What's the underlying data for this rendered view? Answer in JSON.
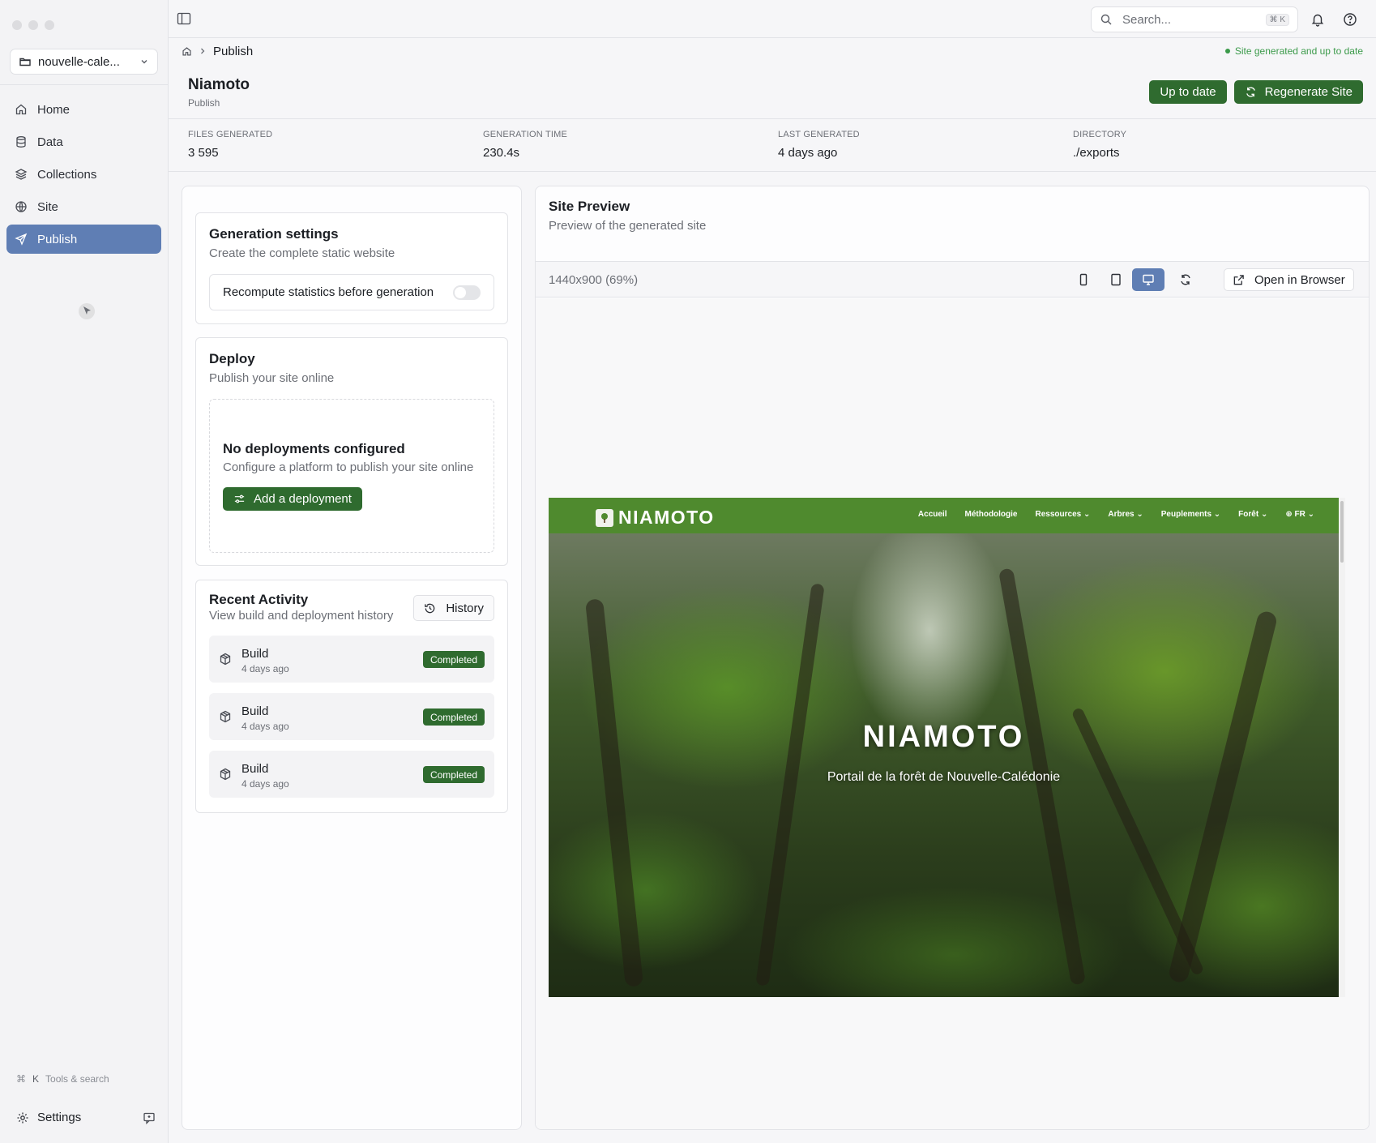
{
  "sidebar": {
    "project": "nouvelle-cale...",
    "items": [
      {
        "label": "Home",
        "icon": "home-icon"
      },
      {
        "label": "Data",
        "icon": "database-icon"
      },
      {
        "label": "Collections",
        "icon": "layers-icon"
      },
      {
        "label": "Site",
        "icon": "globe-icon"
      },
      {
        "label": "Publish",
        "icon": "send-icon",
        "active": true
      }
    ],
    "tools_hint_key": "K",
    "tools_hint_label": "Tools & search",
    "settings_label": "Settings"
  },
  "topbar": {
    "search_placeholder": "Search...",
    "search_shortcut": "⌘ K"
  },
  "breadcrumb": {
    "current": "Publish"
  },
  "status": {
    "text": "Site generated and up to date",
    "color": "#3b9a4a"
  },
  "header": {
    "title": "Niamoto",
    "subtitle": "Publish",
    "up_to_date_label": "Up to date",
    "regenerate_label": "Regenerate Site"
  },
  "stats": [
    {
      "label": "FILES GENERATED",
      "value": "3 595"
    },
    {
      "label": "GENERATION TIME",
      "value": "230.4s"
    },
    {
      "label": "LAST GENERATED",
      "value": "4 days ago"
    },
    {
      "label": "DIRECTORY",
      "value": "./exports"
    }
  ],
  "generation": {
    "title": "Generation settings",
    "subtitle": "Create the complete static website",
    "toggle_label": "Recompute statistics before generation",
    "toggle_on": false
  },
  "deploy": {
    "title": "Deploy",
    "subtitle": "Publish your site online",
    "empty_title": "No deployments configured",
    "empty_subtitle": "Configure a platform to publish your site online",
    "add_label": "Add a deployment"
  },
  "activity": {
    "title": "Recent Activity",
    "subtitle": "View build and deployment history",
    "history_label": "History",
    "items": [
      {
        "title": "Build",
        "time": "4 days ago",
        "status": "Completed"
      },
      {
        "title": "Build",
        "time": "4 days ago",
        "status": "Completed"
      },
      {
        "title": "Build",
        "time": "4 days ago",
        "status": "Completed"
      }
    ]
  },
  "preview": {
    "title": "Site Preview",
    "subtitle": "Preview of the generated site",
    "size": "1440x900 (69%)",
    "open_label": "Open in Browser",
    "site": {
      "logo": "NIAMOTO",
      "menu": [
        "Accueil",
        "Méthodologie",
        "Ressources ⌄",
        "Arbres ⌄",
        "Peuplements ⌄",
        "Forêt ⌄",
        "⊕ FR ⌄"
      ],
      "hero_title": "NIAMOTO",
      "hero_subtitle": "Portail de la forêt de Nouvelle-Calédonie"
    }
  },
  "colors": {
    "accent": "#5f7eb4",
    "primary_green": "#2f6b2f",
    "site_nav_green": "#4f8a2e"
  }
}
